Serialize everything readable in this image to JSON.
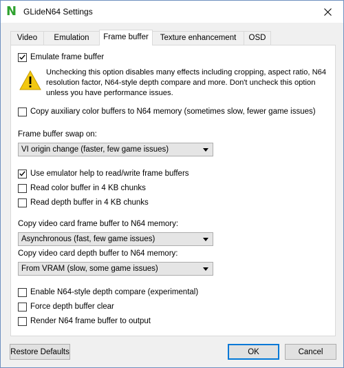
{
  "window": {
    "title": "GLideN64 Settings",
    "close_glyph": "✕"
  },
  "tabs": [
    {
      "label": "Video"
    },
    {
      "label": "Emulation"
    },
    {
      "label": "Frame buffer",
      "active": true
    },
    {
      "label": "Texture enhancement"
    },
    {
      "label": "OSD"
    }
  ],
  "frame_buffer": {
    "emulate": {
      "label": "Emulate frame buffer",
      "checked": true
    },
    "warning": "Unchecking this option disables many effects including cropping, aspect ratio, N64 resolution factor, N64-style depth compare and more. Don't uncheck this option unless you have performance issues.",
    "copy_aux": {
      "label": "Copy auxiliary color buffers to N64 memory (sometimes slow, fewer game issues)",
      "checked": false
    },
    "swap_label": "Frame buffer swap on:",
    "swap_value": "VI origin change (faster, few game issues)",
    "emulator_help": {
      "label": "Use emulator help to read/write frame buffers",
      "checked": true
    },
    "read_color": {
      "label": "Read color buffer in 4 KB chunks",
      "checked": false
    },
    "read_depth": {
      "label": "Read depth buffer in 4 KB chunks",
      "checked": false
    },
    "copy_fb_label": "Copy video card frame buffer to N64 memory:",
    "copy_fb_value": "Asynchronous (fast, few game issues)",
    "copy_depth_label": "Copy video card depth buffer to N64 memory:",
    "copy_depth_value": "From VRAM (slow, some game issues)",
    "depth_compare": {
      "label": "Enable N64-style depth compare (experimental)",
      "checked": false
    },
    "force_clear": {
      "label": "Force depth buffer clear",
      "checked": false
    },
    "render_output": {
      "label": "Render N64 frame buffer to output",
      "checked": false
    }
  },
  "buttons": {
    "restore": "Restore Defaults",
    "ok": "OK",
    "cancel": "Cancel"
  },
  "colors": {
    "accent": "#0078d7",
    "app_icon": "#2fa22f",
    "warning": "#f2c811"
  }
}
